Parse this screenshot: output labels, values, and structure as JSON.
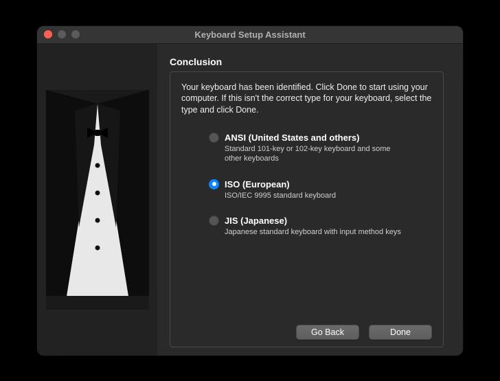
{
  "window": {
    "title": "Keyboard Setup Assistant"
  },
  "heading": "Conclusion",
  "intro": "Your keyboard has been identified. Click Done to start using your computer. If this isn't the correct type for your keyboard, select the type and click Done.",
  "options": [
    {
      "id": "ansi",
      "label": "ANSI (United States and others)",
      "desc": "Standard 101-key or 102-key keyboard and some other keyboards",
      "selected": false
    },
    {
      "id": "iso",
      "label": "ISO (European)",
      "desc": "ISO/IEC 9995 standard keyboard",
      "selected": true
    },
    {
      "id": "jis",
      "label": "JIS (Japanese)",
      "desc": "Japanese standard keyboard with input method keys",
      "selected": false
    }
  ],
  "buttons": {
    "back": "Go Back",
    "done": "Done"
  }
}
